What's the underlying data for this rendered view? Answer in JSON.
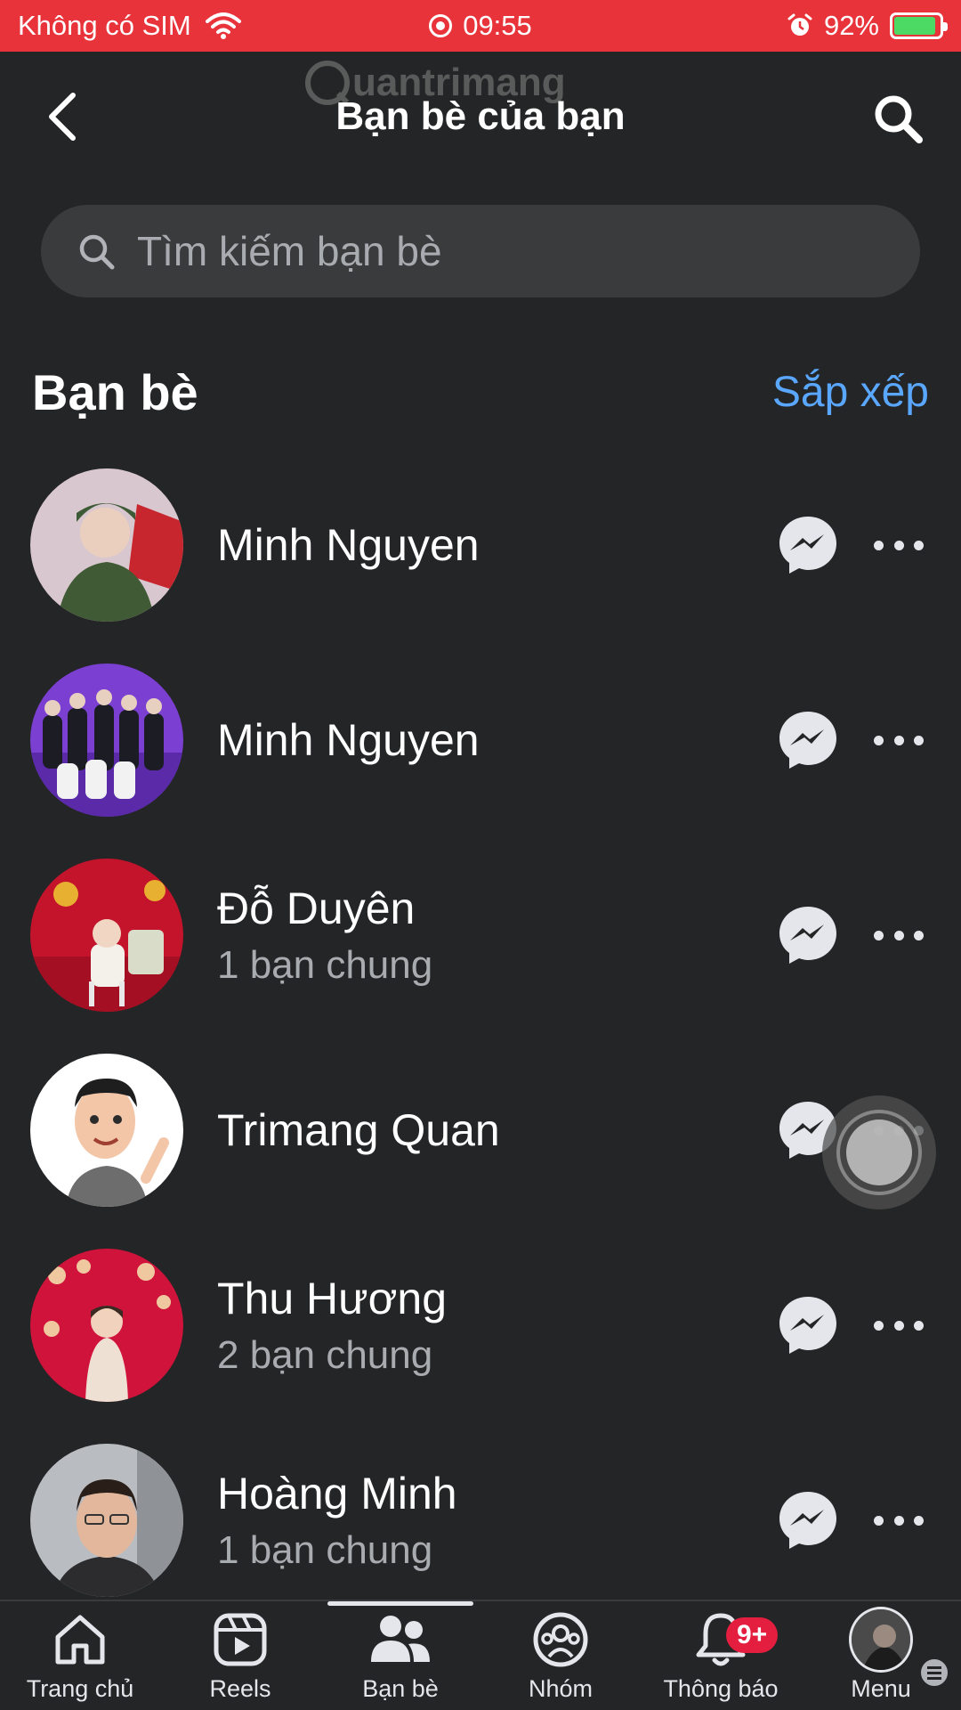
{
  "status_bar": {
    "carrier": "Không có SIM",
    "time": "09:55",
    "battery_percent": "92%",
    "battery_level": 0.92
  },
  "watermark": {
    "text": "uantrimang"
  },
  "header": {
    "title": "Bạn bè của bạn"
  },
  "search": {
    "placeholder": "Tìm kiếm bạn bè"
  },
  "section": {
    "title": "Bạn bè",
    "sort_label": "Sắp xếp"
  },
  "friends": [
    {
      "name": "Minh Nguyen",
      "mutual": ""
    },
    {
      "name": "Minh Nguyen",
      "mutual": ""
    },
    {
      "name": "Đỗ Duyên",
      "mutual": "1 bạn chung"
    },
    {
      "name": "Trimang Quan",
      "mutual": ""
    },
    {
      "name": "Thu Hương",
      "mutual": "2 bạn chung"
    },
    {
      "name": "Hoàng Minh",
      "mutual": "1 bạn chung"
    }
  ],
  "nav": {
    "home": "Trang chủ",
    "reels": "Reels",
    "friends": "Bạn bè",
    "groups": "Nhóm",
    "notifications": "Thông báo",
    "notifications_badge": "9+",
    "menu": "Menu"
  },
  "colors": {
    "status_bar": "#e8333b",
    "background": "#242526",
    "accent": "#5aa7ff",
    "badge": "#e41e3f"
  }
}
